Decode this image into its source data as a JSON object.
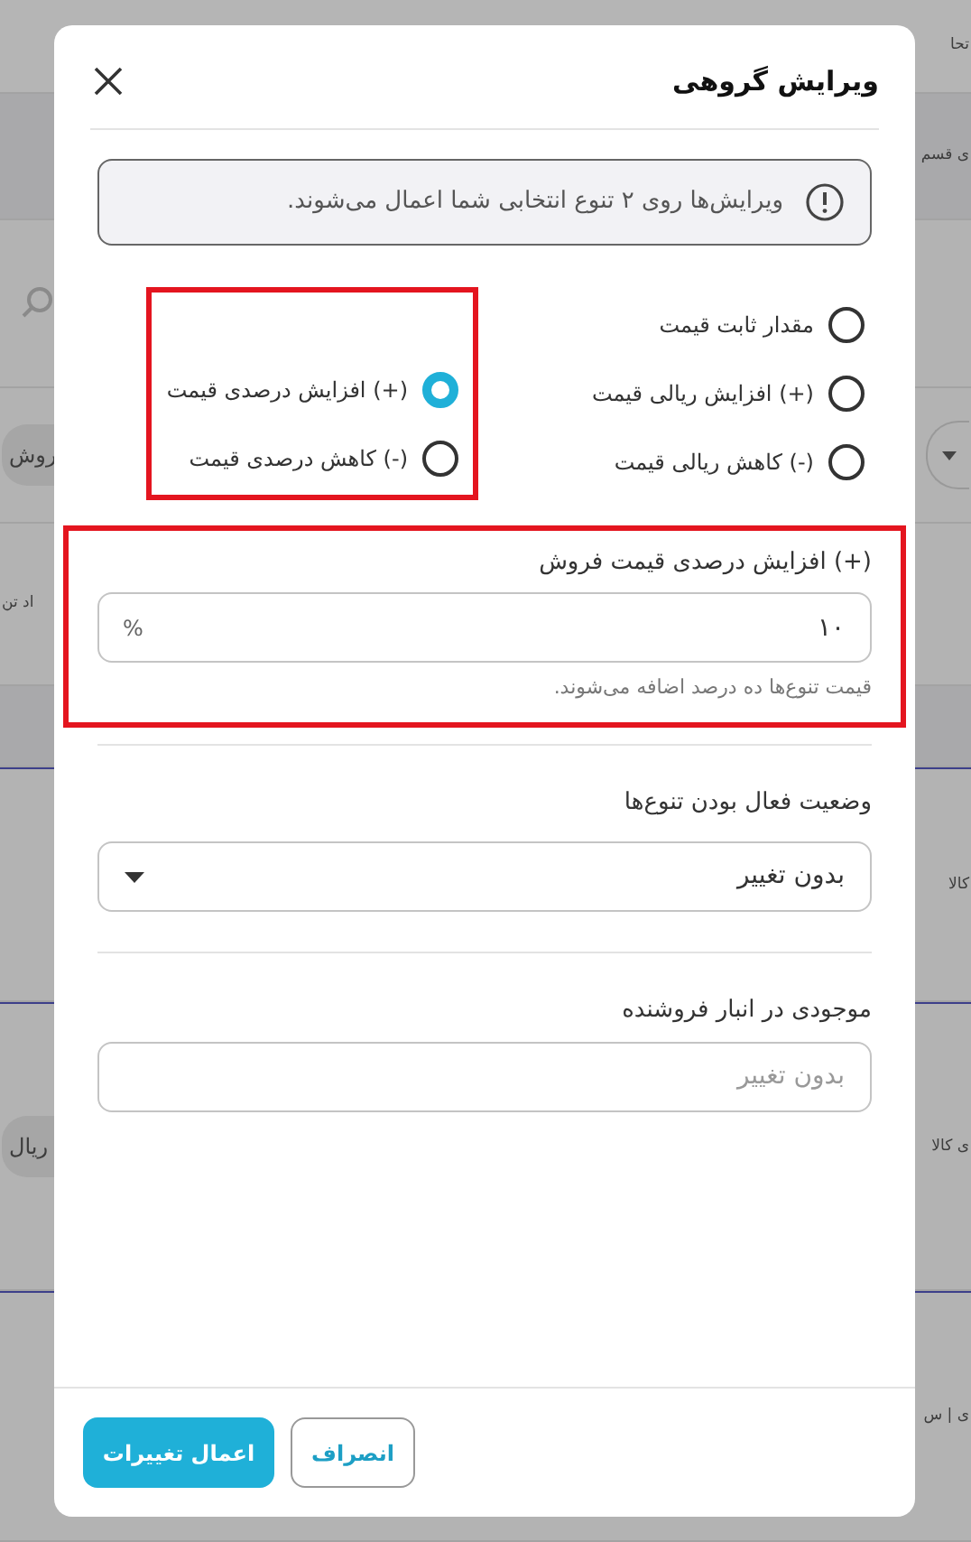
{
  "background_rows": [
    {
      "right": {
        "kind": "text",
        "text": "تحا"
      }
    },
    {
      "right": {
        "kind": "text",
        "text": "ی قسم"
      }
    },
    {
      "left": {
        "kind": "search"
      }
    },
    {
      "left": {
        "kind": "pill",
        "text": "روش"
      },
      "right": {
        "kind": "dropdown"
      }
    },
    {
      "left": {
        "kind": "text",
        "text": "اد تن"
      }
    },
    {},
    {
      "right": {
        "kind": "text",
        "text": "کالا"
      }
    },
    {
      "right": {
        "kind": "text",
        "text": "ی کالا"
      },
      "left": {
        "kind": "pill",
        "text": "ریال"
      }
    },
    {
      "right": {
        "kind": "text",
        "text": "ی | س"
      }
    }
  ],
  "dialog": {
    "title": "ویرایش گروهی",
    "alert": "ویرایش‌ها روی ۲ تنوع انتخابی شما اعمال می‌شوند.",
    "price_mode_columns": [
      {
        "highlighted": false,
        "options": [
          {
            "label": "مقدار ثابت قیمت",
            "selected": false
          },
          {
            "label": "(+) افزایش ریالی قیمت",
            "selected": false
          },
          {
            "label": "(-) کاهش ریالی قیمت",
            "selected": false
          }
        ]
      },
      {
        "highlighted": true,
        "options": [
          {
            "label": "(+) افزایش درصدی قیمت",
            "selected": true
          },
          {
            "label": "(-) کاهش درصدی قیمت",
            "selected": false
          }
        ]
      }
    ],
    "price_field": {
      "highlighted": true,
      "label": "(+) افزایش درصدی قیمت فروش",
      "value": "۱۰",
      "suffix": "%",
      "help": "قیمت تنوع‌ها ده درصد اضافه می‌شوند."
    },
    "status_field": {
      "label": "وضعیت فعال بودن تنوع‌ها",
      "value": "بدون تغییر"
    },
    "stock_field": {
      "label": "موجودی در انبار فروشنده",
      "placeholder": "بدون تغییر"
    },
    "buttons": [
      {
        "kind": "secondary",
        "label": "انصراف"
      },
      {
        "kind": "primary",
        "label": "اعمال تغییرات"
      }
    ]
  }
}
